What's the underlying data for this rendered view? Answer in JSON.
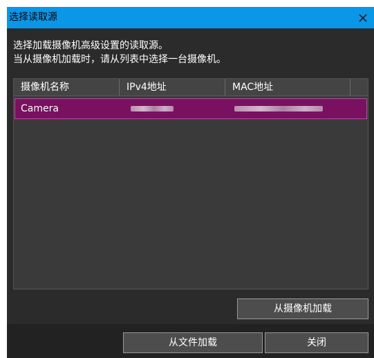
{
  "window": {
    "title": "选择读取源"
  },
  "instructions": {
    "line1": "选择加载摄像机高级设置的读取源。",
    "line2": "当从摄像机加载时，请从列表中选择一台摄像机。"
  },
  "camera_list": {
    "columns": [
      "摄像机名称",
      "IPv4地址",
      "MAC地址"
    ],
    "rows": [
      {
        "name": "Camera"
      }
    ]
  },
  "buttons": {
    "load_from_camera": "从摄像机加载",
    "load_from_file": "从文件加载",
    "close": "关闭"
  },
  "colors": {
    "titlebar": "#0a97e8",
    "selection": "#7a1060",
    "background": "#2b2b2b"
  }
}
